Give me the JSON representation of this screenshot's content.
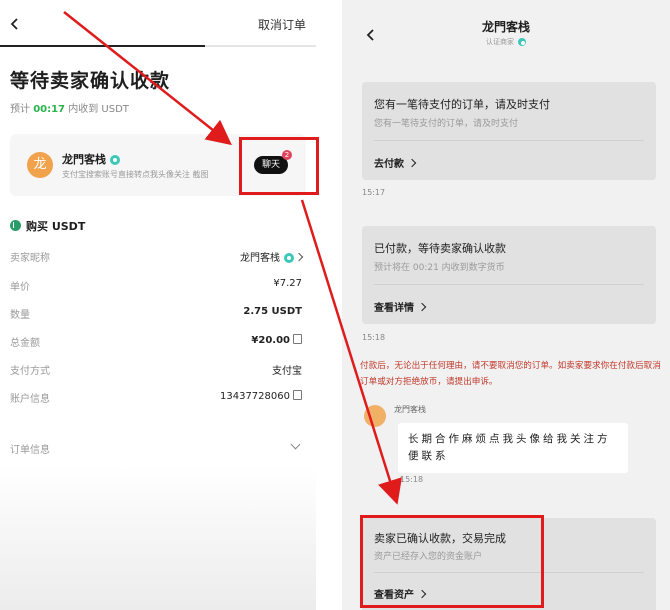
{
  "left_panel": {
    "cancel_order": "取消订单",
    "progress_fraction": 0.65,
    "title": "等待卖家确认收款",
    "eta": {
      "prefix": "预计",
      "time": "00:17",
      "suffix": "内收到 USDT"
    },
    "seller_card": {
      "avatar_text": "龙",
      "merchant_name": "龙門客栈",
      "description": "支付宝搜索账号直接转点我头像关注  截图",
      "chat_button": "聊天",
      "chat_badge": "2"
    },
    "buy_section_title": "购买 USDT",
    "details": [
      {
        "label": "卖家昵称",
        "value": "龙門客栈"
      },
      {
        "label": "单价",
        "value": "¥7.27"
      },
      {
        "label": "数量",
        "value": "2.75 USDT"
      },
      {
        "label": "总金额",
        "value": "¥20.00"
      },
      {
        "label": "支付方式",
        "value": "支付宝"
      },
      {
        "label": "账户信息",
        "value": "13437728060"
      }
    ],
    "order_info_label": "订单信息"
  },
  "right_panel": {
    "title": "龙門客栈",
    "subtitle": "认证商家",
    "cards": [
      {
        "title": "您有一笔待支付的订单，请及时支付",
        "subtitle": "您有一笔待支付的订单，请及时支付",
        "action": "去付款"
      },
      {
        "title": "已付款，等待卖家确认收款",
        "subtitle": "预计将在 00:21 内收到数字货币",
        "action": "查看详情"
      },
      {
        "title": "卖家已确认收款，交易完成",
        "subtitle": "资产已经存入您的资金账户",
        "action": "查看资产"
      }
    ],
    "timestamps": [
      "15:17",
      "15:18"
    ],
    "warning": "付款后，无论出于任何理由，请不要取消您的订单。如卖家要求你在付款后取消订单或对方拒绝放币，请提出申诉。",
    "message": {
      "sender": "龙門客栈",
      "text": "长期合作麻烦点我头像给我关注方便联系",
      "time": "15:18"
    }
  },
  "colors": {
    "accent_green": "#28b34b",
    "annotation_red": "#e01b1b",
    "warning_red": "#c0392b"
  }
}
